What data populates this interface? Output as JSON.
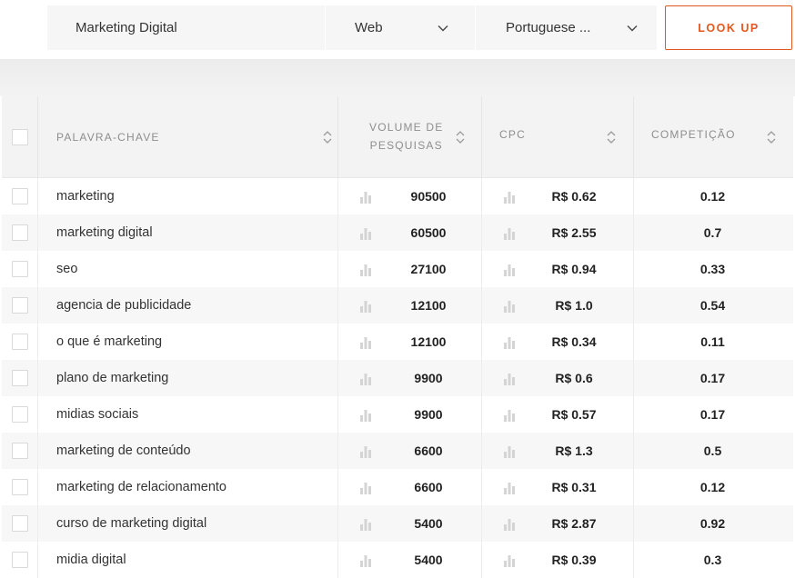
{
  "search": {
    "keyword": "Marketing Digital",
    "platform": "Web",
    "language": "Portuguese ...",
    "lookup_label": "LOOK UP"
  },
  "table": {
    "headers": {
      "keyword": "PALAVRA-CHAVE",
      "volume_line1": "VOLUME DE",
      "volume_line2": "PESQUISAS",
      "cpc": "CPC",
      "competition": "COMPETIÇÃO"
    },
    "rows": [
      {
        "keyword": "marketing",
        "volume": "90500",
        "cpc": "R$ 0.62",
        "competition": "0.12"
      },
      {
        "keyword": "marketing digital",
        "volume": "60500",
        "cpc": "R$ 2.55",
        "competition": "0.7"
      },
      {
        "keyword": "seo",
        "volume": "27100",
        "cpc": "R$ 0.94",
        "competition": "0.33"
      },
      {
        "keyword": "agencia de publicidade",
        "volume": "12100",
        "cpc": "R$ 1.0",
        "competition": "0.54"
      },
      {
        "keyword": "o que é marketing",
        "volume": "12100",
        "cpc": "R$ 0.34",
        "competition": "0.11"
      },
      {
        "keyword": "plano de marketing",
        "volume": "9900",
        "cpc": "R$ 0.6",
        "competition": "0.17"
      },
      {
        "keyword": "midias sociais",
        "volume": "9900",
        "cpc": "R$ 0.57",
        "competition": "0.17"
      },
      {
        "keyword": "marketing de conteúdo",
        "volume": "6600",
        "cpc": "R$ 1.3",
        "competition": "0.5"
      },
      {
        "keyword": "marketing de relacionamento",
        "volume": "6600",
        "cpc": "R$ 0.31",
        "competition": "0.12"
      },
      {
        "keyword": "curso de marketing digital",
        "volume": "5400",
        "cpc": "R$ 2.87",
        "competition": "0.92"
      },
      {
        "keyword": "midia digital",
        "volume": "5400",
        "cpc": "R$ 0.39",
        "competition": "0.3"
      }
    ]
  },
  "colors": {
    "accent": "#e4571e",
    "header_text": "#8e8e8e",
    "row_alt": "#f7f7f7"
  }
}
